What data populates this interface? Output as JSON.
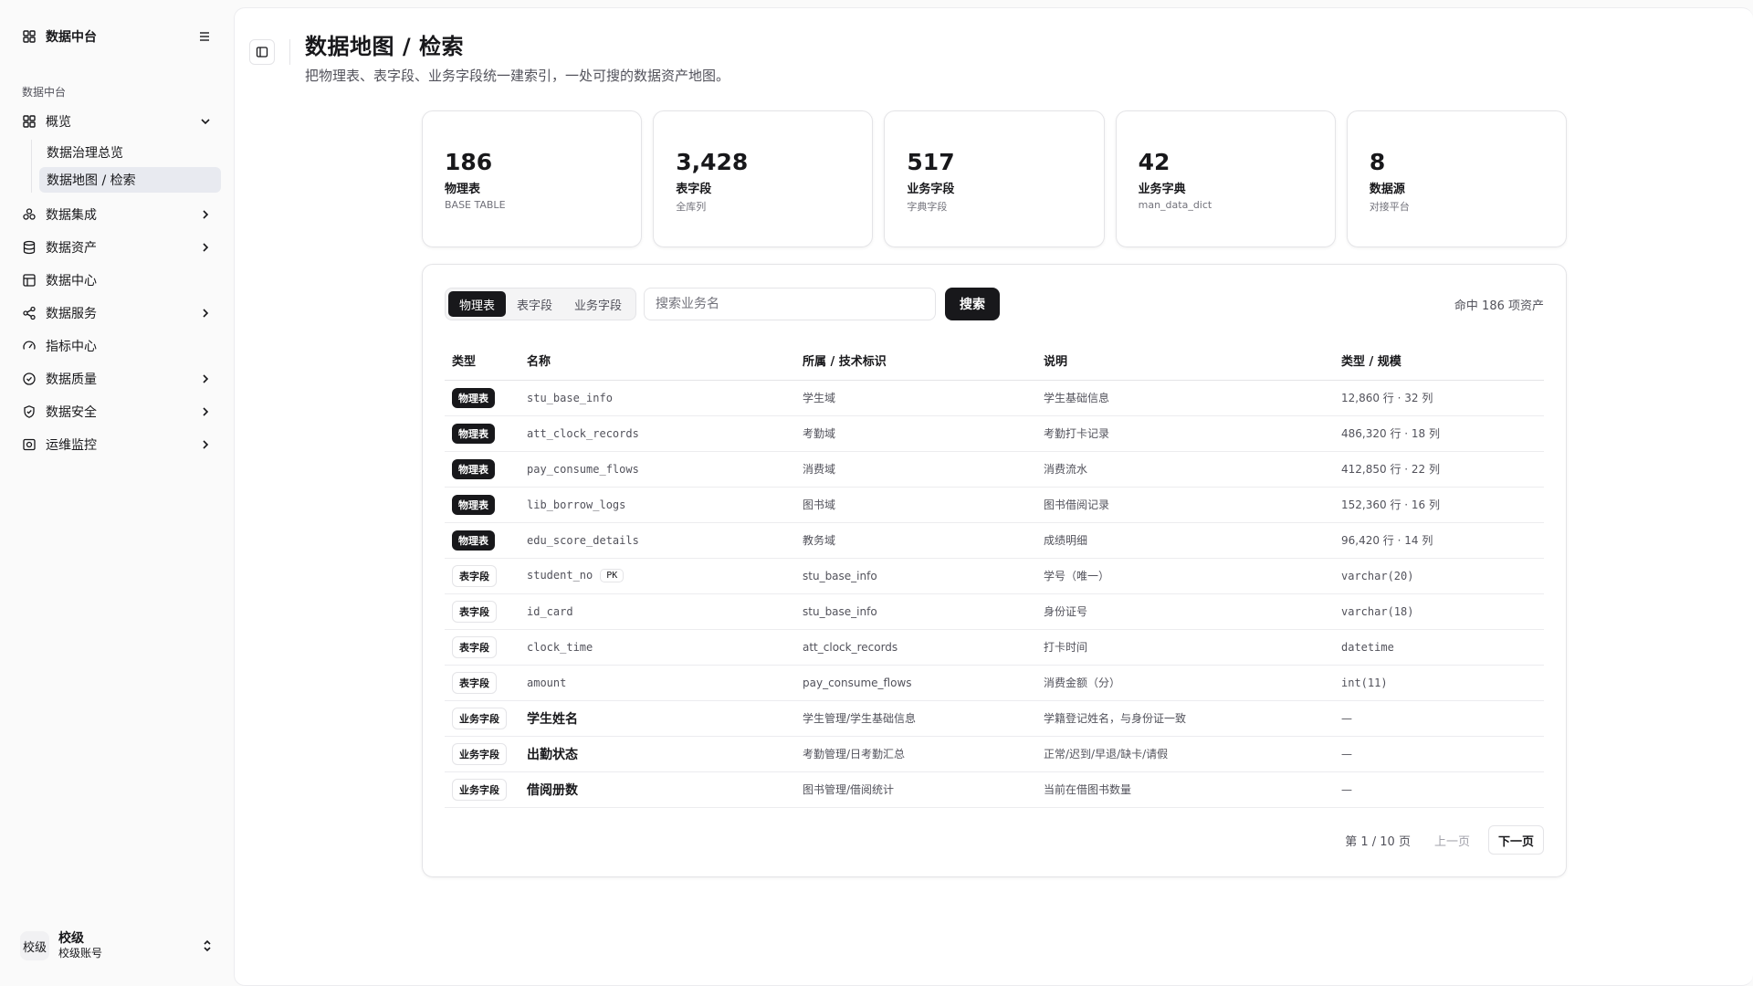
{
  "sidebar": {
    "brand": "数据中台",
    "group_label": "数据中台",
    "overview": {
      "label": "概览",
      "items": [
        {
          "label": "数据治理总览"
        },
        {
          "label": "数据地图 / 检索"
        }
      ]
    },
    "items": [
      {
        "label": "数据集成"
      },
      {
        "label": "数据资产"
      },
      {
        "label": "数据中心"
      },
      {
        "label": "数据服务"
      },
      {
        "label": "指标中心"
      },
      {
        "label": "数据质量"
      },
      {
        "label": "数据安全"
      },
      {
        "label": "运维监控"
      }
    ],
    "user": {
      "avatar": "校级",
      "name": "校级",
      "account": "校级账号"
    }
  },
  "header": {
    "title": "数据地图 / 检索",
    "subtitle": "把物理表、表字段、业务字段统一建索引，一处可搜的数据资产地图。"
  },
  "stats": [
    {
      "value": "186",
      "label": "物理表",
      "sub": "BASE TABLE"
    },
    {
      "value": "3,428",
      "label": "表字段",
      "sub": "全库列"
    },
    {
      "value": "517",
      "label": "业务字段",
      "sub": "字典字段"
    },
    {
      "value": "42",
      "label": "业务字典",
      "sub": "man_data_dict"
    },
    {
      "value": "8",
      "label": "数据源",
      "sub": "对接平台"
    }
  ],
  "search": {
    "tabs": [
      {
        "label": "物理表"
      },
      {
        "label": "表字段"
      },
      {
        "label": "业务字段"
      }
    ],
    "active_tab": "物理表",
    "placeholder": "搜索业务名",
    "button": "搜索",
    "hit_count": "命中 186 项资产"
  },
  "table": {
    "headers": [
      "类型",
      "名称",
      "所属 / 技术标识",
      "说明",
      "类型 / 规模"
    ],
    "rows": [
      {
        "type": "物理表",
        "name": "stu_base_info",
        "owner": "学生域",
        "desc": "学生基础信息",
        "scale": "12,860 行 · 32 列"
      },
      {
        "type": "物理表",
        "name": "att_clock_records",
        "owner": "考勤域",
        "desc": "考勤打卡记录",
        "scale": "486,320 行 · 18 列"
      },
      {
        "type": "物理表",
        "name": "pay_consume_flows",
        "owner": "消费域",
        "desc": "消费流水",
        "scale": "412,850 行 · 22 列"
      },
      {
        "type": "物理表",
        "name": "lib_borrow_logs",
        "owner": "图书域",
        "desc": "图书借阅记录",
        "scale": "152,360 行 · 16 列"
      },
      {
        "type": "物理表",
        "name": "edu_score_details",
        "owner": "教务域",
        "desc": "成绩明细",
        "scale": "96,420 行 · 14 列"
      },
      {
        "type": "表字段",
        "name": "student_no",
        "pk": "PK",
        "owner": "stu_base_info",
        "desc": "学号（唯一）",
        "scale": "varchar(20)"
      },
      {
        "type": "表字段",
        "name": "id_card",
        "owner": "stu_base_info",
        "desc": "身份证号",
        "scale": "varchar(18)"
      },
      {
        "type": "表字段",
        "name": "clock_time",
        "owner": "att_clock_records",
        "desc": "打卡时间",
        "scale": "datetime"
      },
      {
        "type": "表字段",
        "name": "amount",
        "owner": "pay_consume_flows",
        "desc": "消费金额（分）",
        "scale": "int(11)"
      },
      {
        "type": "业务字段",
        "name": "学生姓名",
        "owner": "学生管理/学生基础信息",
        "desc": "学籍登记姓名，与身份证一致",
        "scale": "—"
      },
      {
        "type": "业务字段",
        "name": "出勤状态",
        "owner": "考勤管理/日考勤汇总",
        "desc": "正常/迟到/早退/缺卡/请假",
        "scale": "—"
      },
      {
        "type": "业务字段",
        "name": "借阅册数",
        "owner": "图书管理/借阅统计",
        "desc": "当前在借图书数量",
        "scale": "—"
      }
    ]
  },
  "pager": {
    "info": "第 1 / 10 页",
    "prev": "上一页",
    "next": "下一页"
  }
}
